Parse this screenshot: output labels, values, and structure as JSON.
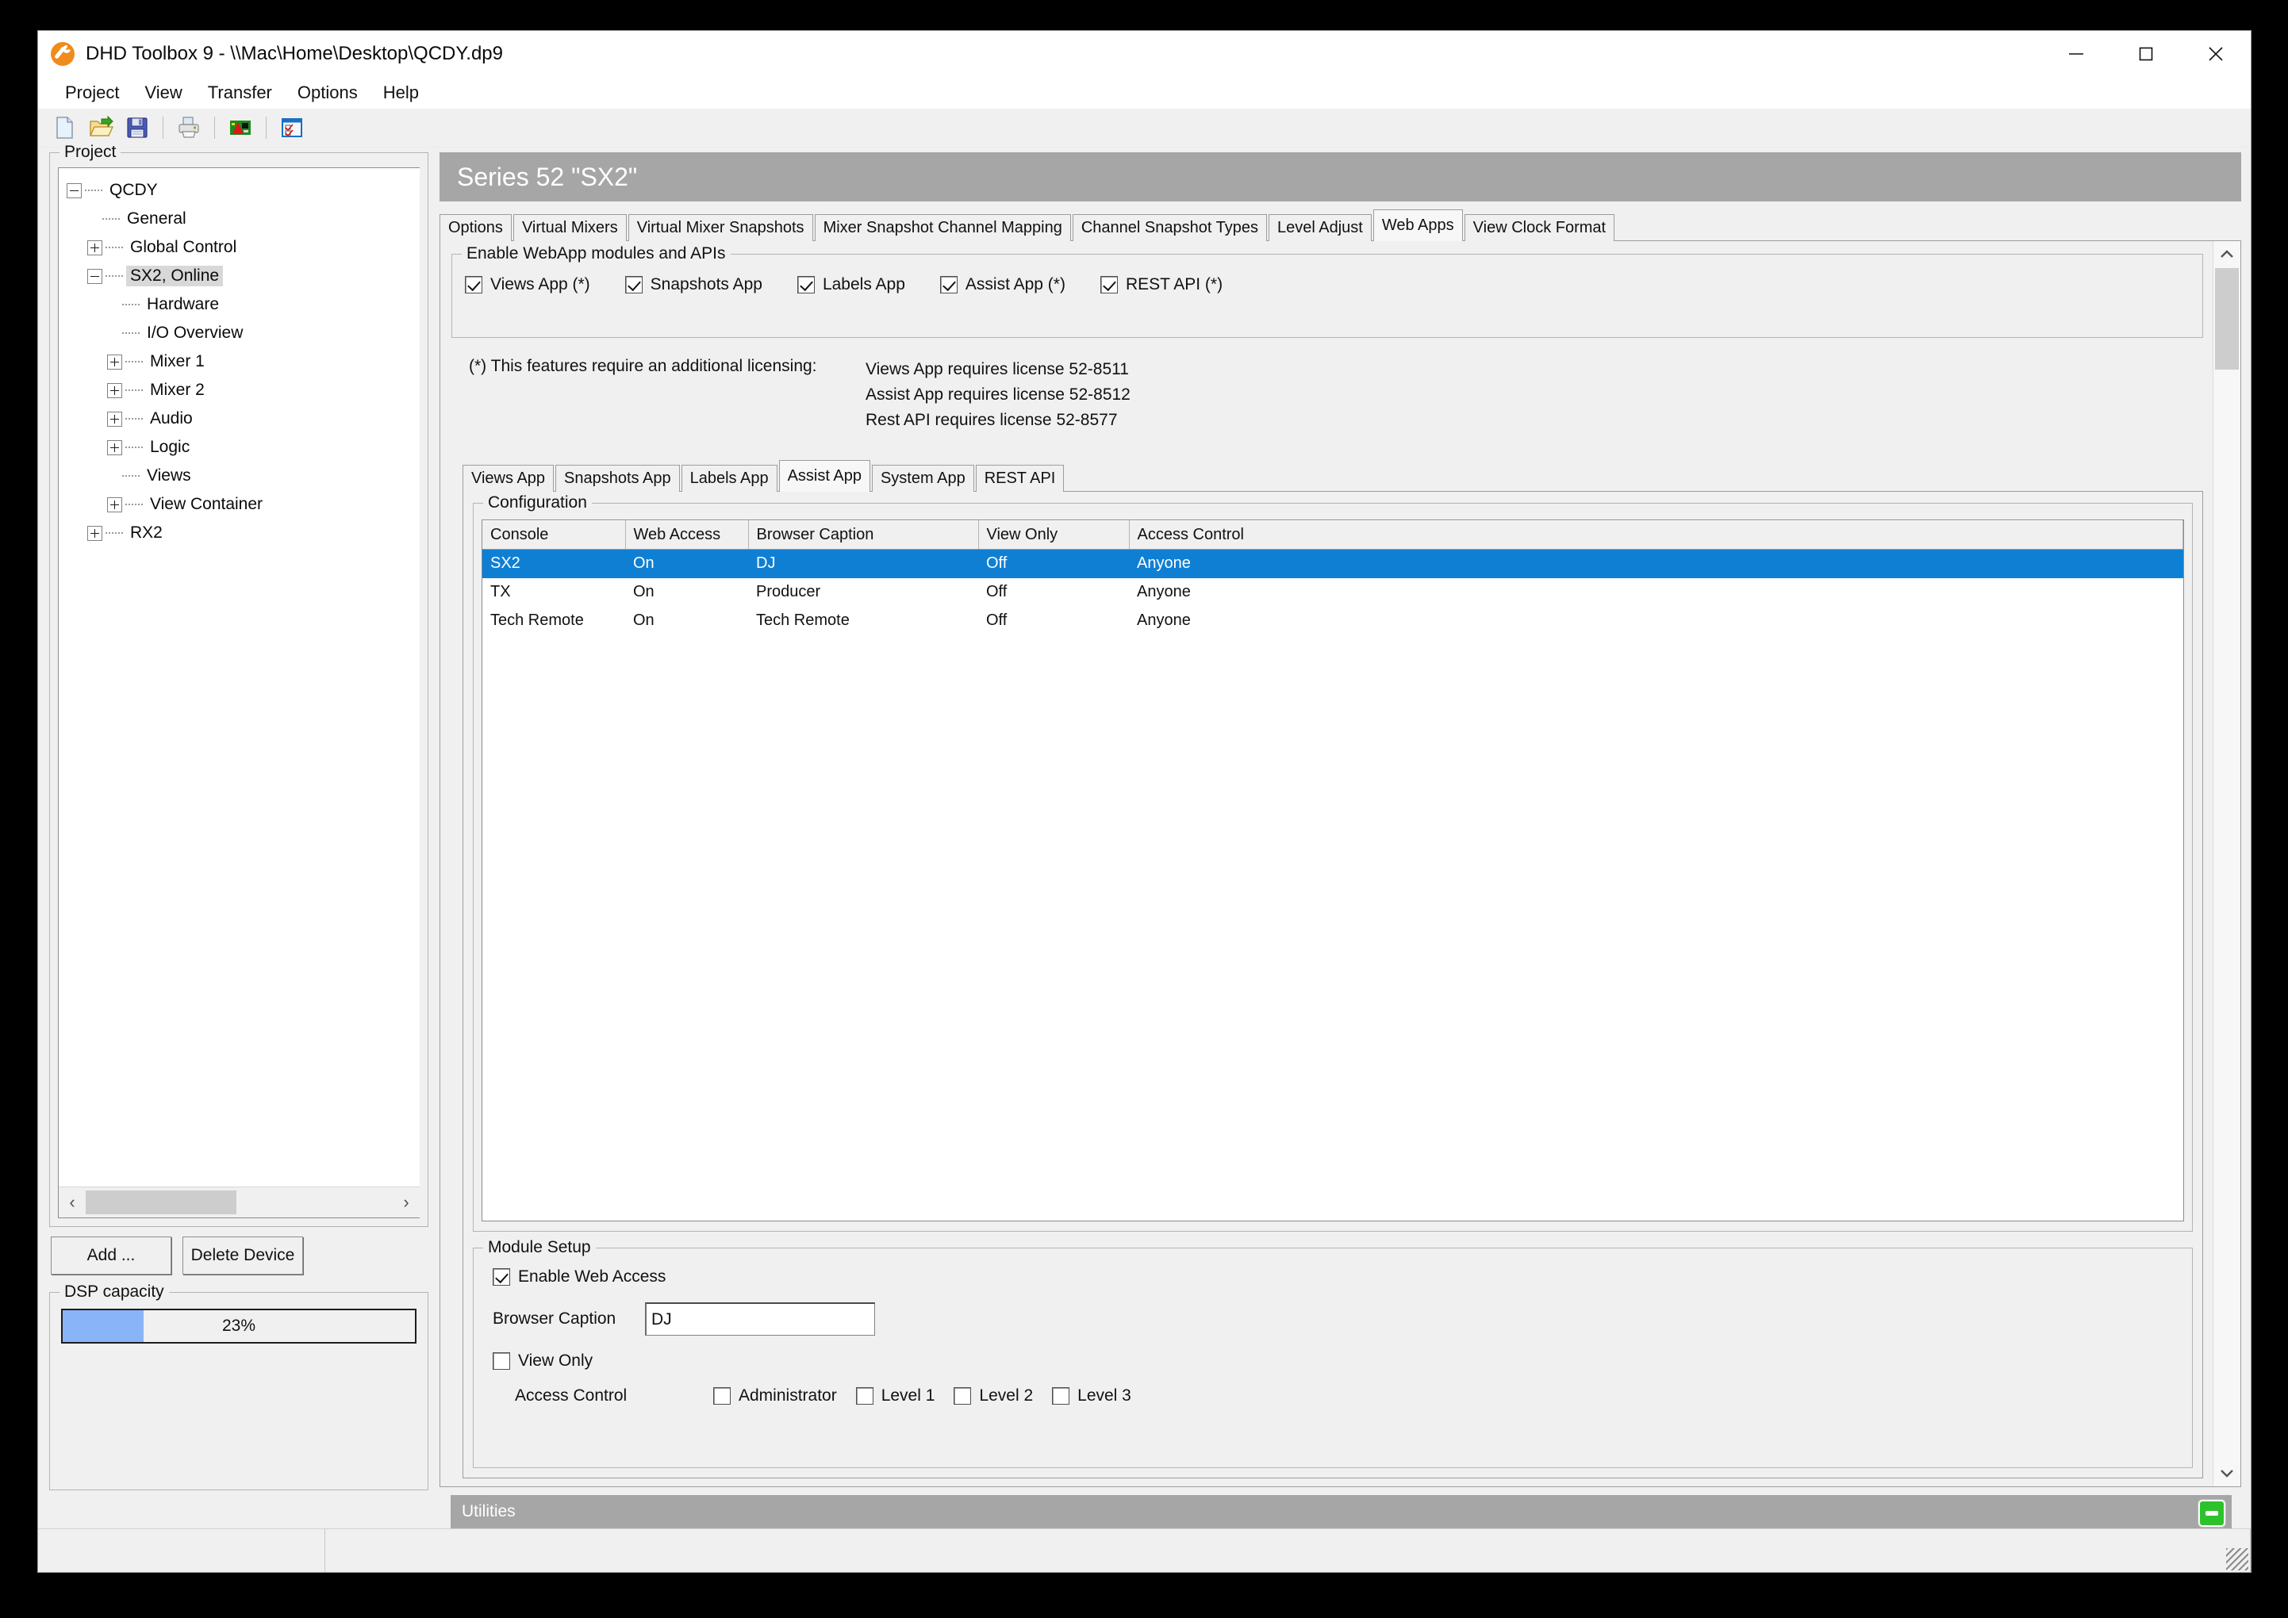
{
  "window": {
    "title": "DHD Toolbox 9 - \\\\Mac\\Home\\Desktop\\QCDY.dp9",
    "app_icon": "wrench-icon",
    "minimize_label": "Minimize",
    "maximize_label": "Maximize",
    "close_label": "Close"
  },
  "menubar": {
    "items": [
      {
        "label": "Project"
      },
      {
        "label": "View"
      },
      {
        "label": "Transfer"
      },
      {
        "label": "Options"
      },
      {
        "label": "Help"
      }
    ]
  },
  "toolbar": {
    "buttons": [
      {
        "icon": "new-document-icon",
        "label": "New"
      },
      {
        "icon": "open-folder-icon",
        "label": "Open"
      },
      {
        "icon": "save-floppy-icon",
        "label": "Save"
      },
      {
        "icon": "printer-icon",
        "label": "Print"
      },
      {
        "icon": "network-card-icon",
        "label": "Transfer"
      },
      {
        "icon": "checklist-window-icon",
        "label": "Options"
      }
    ]
  },
  "sidebar": {
    "group_label": "Project",
    "tree": [
      {
        "label": "QCDY",
        "depth": 0,
        "toggle": "minus",
        "selected": false
      },
      {
        "label": "General",
        "depth": 1,
        "toggle": "none",
        "selected": false
      },
      {
        "label": "Global Control",
        "depth": 1,
        "toggle": "plus",
        "selected": false
      },
      {
        "label": "SX2, Online",
        "depth": 1,
        "toggle": "minus",
        "selected": true
      },
      {
        "label": "Hardware",
        "depth": 2,
        "toggle": "none",
        "selected": false
      },
      {
        "label": "I/O Overview",
        "depth": 2,
        "toggle": "none",
        "selected": false
      },
      {
        "label": "Mixer 1",
        "depth": 2,
        "toggle": "plus",
        "selected": false
      },
      {
        "label": "Mixer 2",
        "depth": 2,
        "toggle": "plus",
        "selected": false
      },
      {
        "label": "Audio",
        "depth": 2,
        "toggle": "plus",
        "selected": false
      },
      {
        "label": "Logic",
        "depth": 2,
        "toggle": "plus",
        "selected": false
      },
      {
        "label": "Views",
        "depth": 2,
        "toggle": "none",
        "selected": false
      },
      {
        "label": "View Container",
        "depth": 2,
        "toggle": "plus",
        "selected": false
      },
      {
        "label": "RX2",
        "depth": 1,
        "toggle": "plus",
        "selected": false
      }
    ],
    "buttons": {
      "add": "Add ...",
      "delete": "Delete Device"
    },
    "dsp": {
      "group_label": "DSP capacity",
      "value_label": "23%",
      "percent": 23,
      "fill_color": "#8ab4f8"
    },
    "hscroll": {
      "left_arrow": "‹",
      "right_arrow": "›"
    }
  },
  "main": {
    "header_title": "Series 52 \"SX2\"",
    "outer_tabs": [
      {
        "label": "Options",
        "active": false
      },
      {
        "label": "Virtual Mixers",
        "active": false
      },
      {
        "label": "Virtual Mixer Snapshots",
        "active": false
      },
      {
        "label": "Mixer Snapshot Channel Mapping",
        "active": false
      },
      {
        "label": "Channel Snapshot Types",
        "active": false
      },
      {
        "label": "Level Adjust",
        "active": false
      },
      {
        "label": "Web Apps",
        "active": true
      },
      {
        "label": "View Clock Format",
        "active": false
      }
    ],
    "enable_group": {
      "label": "Enable WebApp modules and APIs",
      "checkboxes": [
        {
          "label": "Views App (*)",
          "checked": true
        },
        {
          "label": "Snapshots App",
          "checked": true
        },
        {
          "label": "Labels App",
          "checked": true
        },
        {
          "label": "Assist App (*)",
          "checked": true
        },
        {
          "label": "REST API (*)",
          "checked": true
        }
      ]
    },
    "license_note": {
      "intro": "(*) This features require an additional licensing:",
      "lines": [
        "Views App requires license 52-8511",
        "Assist App requires license 52-8512",
        "Rest API requires license 52-8577"
      ]
    },
    "inner_tabs": [
      {
        "label": "Views App",
        "active": false
      },
      {
        "label": "Snapshots App",
        "active": false
      },
      {
        "label": "Labels App",
        "active": false
      },
      {
        "label": "Assist App",
        "active": true
      },
      {
        "label": "System App",
        "active": false
      },
      {
        "label": "REST API",
        "active": false
      }
    ],
    "configuration": {
      "group_label": "Configuration",
      "columns": [
        "Console",
        "Web Access",
        "Browser Caption",
        "View Only",
        "Access Control"
      ],
      "rows": [
        {
          "cells": [
            "SX2",
            "On",
            "DJ",
            "Off",
            "Anyone"
          ],
          "selected": true
        },
        {
          "cells": [
            "TX",
            "On",
            "Producer",
            "Off",
            "Anyone"
          ],
          "selected": false
        },
        {
          "cells": [
            "Tech Remote",
            "On",
            "Tech Remote",
            "Off",
            "Anyone"
          ],
          "selected": false
        }
      ],
      "selection_color": "#0f7fd4"
    },
    "module_setup": {
      "group_label": "Module Setup",
      "enable_web_access": {
        "label": "Enable Web Access",
        "checked": true
      },
      "browser_caption": {
        "label": "Browser Caption",
        "value": "DJ",
        "placeholder": ""
      },
      "view_only": {
        "label": "View Only",
        "checked": false
      },
      "access_control": {
        "label": "Access Control",
        "options": [
          {
            "label": "Administrator",
            "checked": false
          },
          {
            "label": "Level 1",
            "checked": false
          },
          {
            "label": "Level 2",
            "checked": false
          },
          {
            "label": "Level 3",
            "checked": false
          }
        ]
      }
    },
    "vscroll": {
      "up_arrow": "⌃",
      "down_arrow": "⌄"
    }
  },
  "utilities_bar": {
    "label": "Utilities",
    "led": "green-status-led",
    "led_color": "#2cc22c"
  },
  "statusbar": {
    "left_text": "",
    "right_text": ""
  }
}
